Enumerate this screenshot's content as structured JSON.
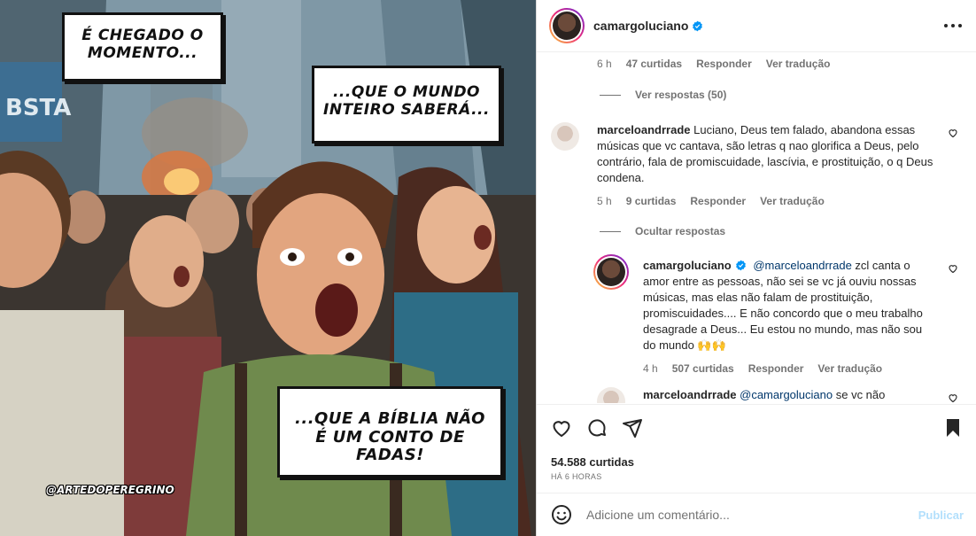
{
  "post": {
    "image_text": {
      "bubble1": "É CHEGADO O MOMENTO...",
      "bubble2": "...QUE O MUNDO INTEIRO SABERÁ...",
      "bubble3": "...QUE A BÍBLIA NÃO É UM CONTO DE FADAS!",
      "watermark": "@ARTEDOPEREGRINO",
      "sign": "BSTA"
    }
  },
  "header": {
    "username": "camargoluciano",
    "verified": true
  },
  "comments": {
    "top_meta": {
      "time": "6 h",
      "likes": "47 curtidas",
      "reply": "Responder",
      "translate": "Ver tradução"
    },
    "view_replies": "Ver respostas (50)",
    "comment1": {
      "username": "marceloandrrade",
      "text": "Luciano, Deus tem falado, abandona essas músicas que vc cantava, são letras q nao glorifica a Deus, pelo contrário, fala de promiscuidade, lascívia, e prostituição, o q Deus condena.",
      "time": "5 h",
      "likes": "9 curtidas",
      "reply": "Responder",
      "translate": "Ver tradução"
    },
    "hide_replies": "Ocultar respostas",
    "reply1": {
      "username": "camargoluciano",
      "mention": "@marceloandrrade",
      "text": " zcl canta o amor entre as pessoas, não sei se vc já ouviu nossas músicas, mas elas não falam de prostituição, promiscuidades.... E não concordo que o meu trabalho desagrade a Deus... Eu estou no mundo, mas não sou do mundo 🙌🙌",
      "time": "4 h",
      "likes": "507 curtidas",
      "reply": "Responder",
      "translate": "Ver tradução"
    },
    "reply2": {
      "username": "marceloandrrade",
      "mention": "@camargoluciano",
      "text": " se vc não"
    }
  },
  "actions": {
    "likes": "54.588 curtidas",
    "time": "HÁ 6 HORAS"
  },
  "add_comment": {
    "placeholder": "Adicione um comentário...",
    "post_label": "Publicar"
  },
  "colors": {
    "verified": "#0095f6",
    "link": "#00376b",
    "muted": "#737373",
    "post_disabled": "#b2dffc"
  }
}
